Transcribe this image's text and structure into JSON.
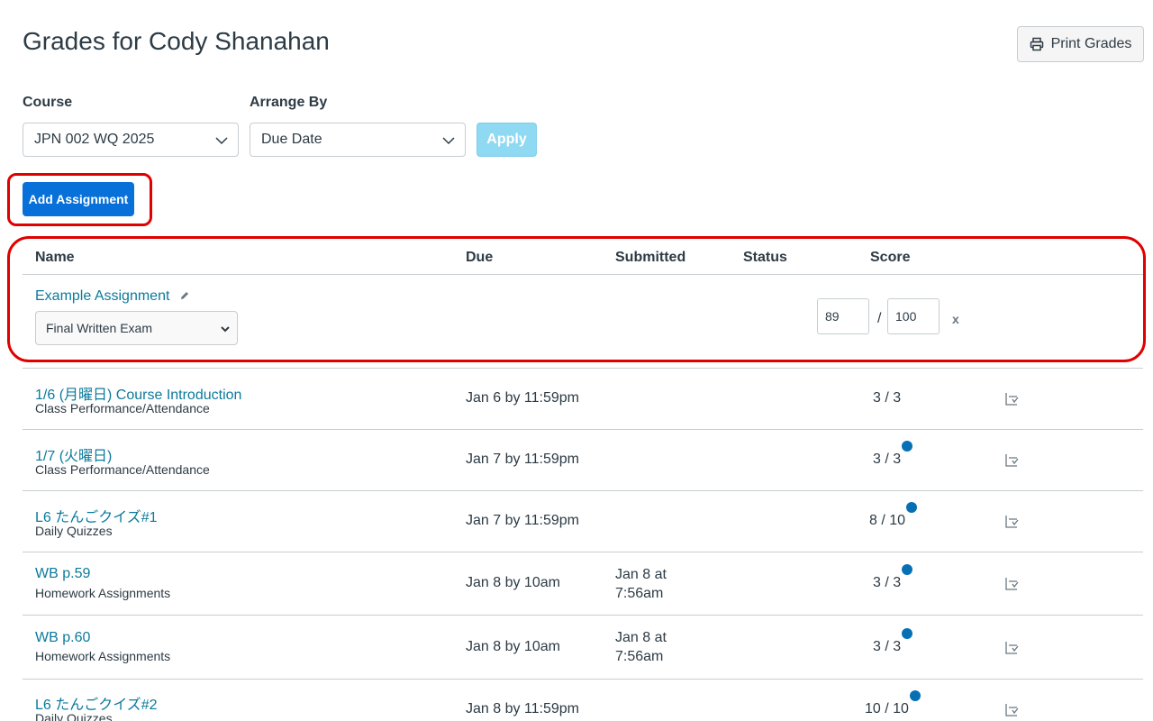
{
  "page": {
    "title": "Grades for Cody Shanahan"
  },
  "toolbar": {
    "print_label": "Print Grades"
  },
  "filters": {
    "course_label": "Course",
    "course_value": "JPN 002 WQ 2025",
    "arrange_label": "Arrange By",
    "arrange_value": "Due Date",
    "apply_label": "Apply"
  },
  "add_assignment_label": "Add Assignment",
  "table": {
    "headers": {
      "name": "Name",
      "due": "Due",
      "submitted": "Submitted",
      "status": "Status",
      "score": "Score"
    }
  },
  "example": {
    "name": "Example Assignment",
    "group_value": "Final Written Exam",
    "score_value": "89",
    "points_value": "100",
    "slash": "/",
    "remove": "x"
  },
  "rows": [
    {
      "name": "1/6 (月曜日) Course Introduction",
      "category": "Class Performance/Attendance",
      "due": "Jan 6 by 11:59pm",
      "submitted_1": "",
      "submitted_2": "",
      "score": "3 / 3",
      "has_dot": false
    },
    {
      "name": "1/7 (火曜日)",
      "category": "Class Performance/Attendance",
      "due": "Jan 7 by 11:59pm",
      "submitted_1": "",
      "submitted_2": "",
      "score": "3 / 3",
      "has_dot": true
    },
    {
      "name": "L6 たんごクイズ#1",
      "category": "Daily Quizzes",
      "due": "Jan 7 by 11:59pm",
      "submitted_1": "",
      "submitted_2": "",
      "score": "8 / 10",
      "has_dot": true
    },
    {
      "name": "WB p.59",
      "category": "Homework Assignments",
      "due": "Jan 8 by 10am",
      "submitted_1": "Jan 8 at",
      "submitted_2": "7:56am",
      "score": "3 / 3",
      "has_dot": true
    },
    {
      "name": "WB p.60",
      "category": "Homework Assignments",
      "due": "Jan 8 by 10am",
      "submitted_1": "Jan 8 at",
      "submitted_2": "7:56am",
      "score": "3 / 3",
      "has_dot": true
    },
    {
      "name": "L6 たんごクイズ#2",
      "category": "Daily Quizzes",
      "due": "Jan 8 by 11:59pm",
      "submitted_1": "",
      "submitted_2": "",
      "score": "10 / 10",
      "has_dot": true
    }
  ],
  "icons": {
    "print": "printer-icon",
    "dropdown": "chevron-down-icon",
    "edit": "pencil-icon",
    "rubric": "rubric-icon",
    "unread": "unread-dot-icon"
  },
  "colors": {
    "link": "#0b7a9c",
    "primary": "#0770d9",
    "apply_disabled": "#8fd9f2",
    "highlight": "#e00000",
    "dot": "#0770b4"
  }
}
